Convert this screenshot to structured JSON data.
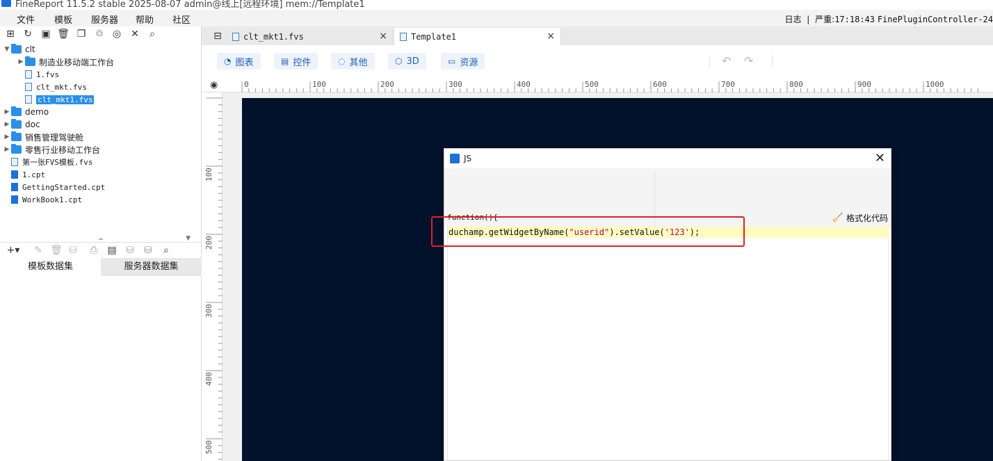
{
  "window": {
    "title": "FineReport 11.5.2 stable 2025-08-07 admin@线上[远程环境]     mem://Template1"
  },
  "menu": [
    "文件",
    "模板",
    "服务器",
    "帮助",
    "社区"
  ],
  "status": {
    "log_label": "日志",
    "separator": "|",
    "level": "严重:",
    "time": "17:18:43",
    "source": "FinePluginController-24"
  },
  "tree": {
    "items": [
      {
        "label": "clt",
        "type": "folder",
        "level": 0,
        "expanded": true
      },
      {
        "label": "制造业移动端工作台",
        "type": "folder",
        "level": 1,
        "expanded": false
      },
      {
        "label": "1.fvs",
        "type": "fvs",
        "level": 1
      },
      {
        "label": "clt_mkt.fvs",
        "type": "fvs",
        "level": 1
      },
      {
        "label": "clt_mkt1.fvs",
        "type": "fvs",
        "level": 1,
        "selected": true
      },
      {
        "label": "demo",
        "type": "folder",
        "level": 0,
        "expanded": false
      },
      {
        "label": "doc",
        "type": "folder",
        "level": 0,
        "expanded": false
      },
      {
        "label": "销售管理驾驶舱",
        "type": "folder",
        "level": 0,
        "expanded": false
      },
      {
        "label": "零售行业移动工作台",
        "type": "folder",
        "level": 0,
        "expanded": false
      },
      {
        "label": "第一张FVS模板.fvs",
        "type": "fvs",
        "level": 0
      },
      {
        "label": "1.cpt",
        "type": "cpt",
        "level": 0
      },
      {
        "label": "GettingStarted.cpt",
        "type": "cpt",
        "level": 0
      },
      {
        "label": "WorkBook1.cpt",
        "type": "cpt",
        "level": 0
      }
    ]
  },
  "dataset_tabs": {
    "template": "模板数据集",
    "server": "服务器数据集"
  },
  "doc_tabs": [
    {
      "label": "clt_mkt1.fvs",
      "active": false
    },
    {
      "label": "Template1",
      "active": true
    }
  ],
  "toolbar": {
    "chart": "图表",
    "widget": "控件",
    "other": "其他",
    "three_d": "3D",
    "resource": "资源"
  },
  "ruler": {
    "h_labels": [
      "0",
      "100",
      "200",
      "300",
      "400",
      "500",
      "600",
      "700",
      "800",
      "900",
      "1000"
    ],
    "v_labels": [
      "100",
      "200",
      "300",
      "400",
      "500"
    ]
  },
  "dialog": {
    "title": "JS",
    "function_header": "function(){",
    "format_button": "格式化代码",
    "code": {
      "prefix": "duchamp.getWidgetByName(",
      "arg1": "\"userid\"",
      "middle": ").setValue(",
      "arg2": "'123'",
      "suffix": ");"
    }
  },
  "colors": {
    "accent": "#2b8fe8",
    "canvas": "#03122b",
    "highlight": "#e02020",
    "code_line": "#fffbbf"
  }
}
